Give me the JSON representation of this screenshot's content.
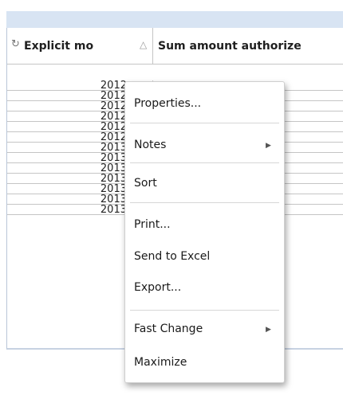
{
  "table": {
    "columns": [
      {
        "label": "Explicit mo"
      },
      {
        "label": "Sum amount authorize"
      }
    ],
    "rows": [
      "2012",
      "2012",
      "2012",
      "2012",
      "2012",
      "2012",
      "2013",
      "2013",
      "2013",
      "2013",
      "2013",
      "2013",
      "2013"
    ]
  },
  "context_menu": {
    "items": [
      {
        "label": "Properties..."
      },
      {
        "label": "Notes",
        "submenu": true
      },
      {
        "label": "Sort"
      },
      {
        "label": "Print..."
      },
      {
        "label": "Send to Excel"
      },
      {
        "label": "Export..."
      },
      {
        "label": "Fast Change",
        "submenu": true
      },
      {
        "label": "Maximize"
      }
    ]
  },
  "icons": {
    "cycle_icon": "refresh-icon",
    "sort_icon": "sort-triangle-icon",
    "submenu_arrow": "triangle-right-icon"
  }
}
